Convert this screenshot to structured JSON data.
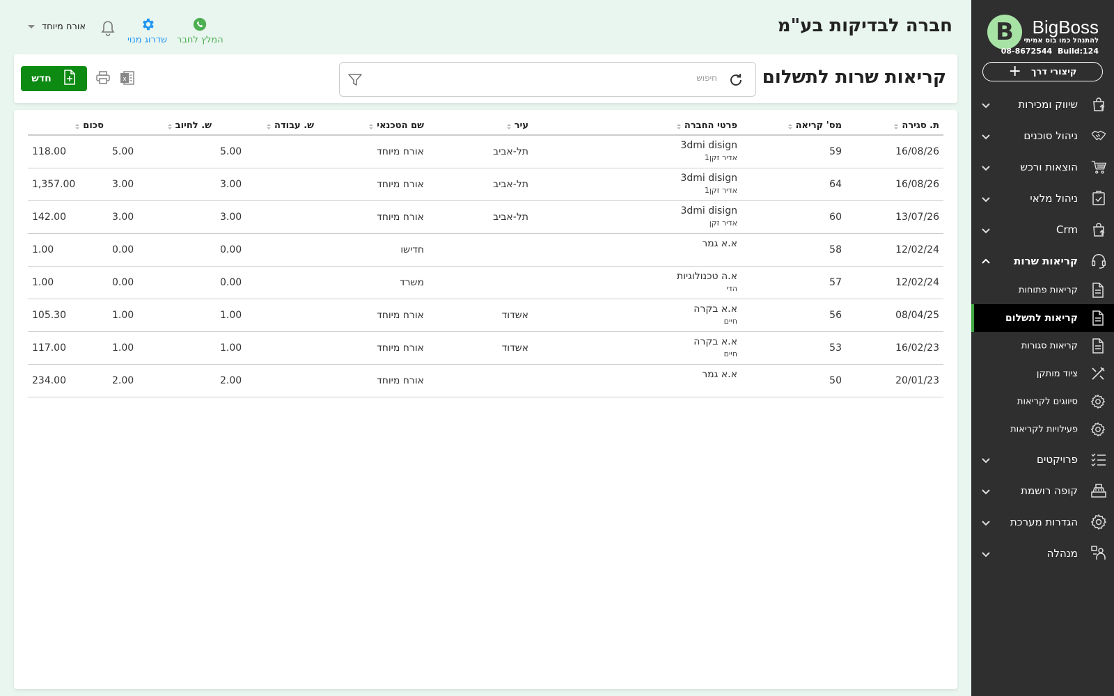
{
  "app": {
    "logo_letter": "B",
    "logo_name": "BigBoss",
    "tagline": "להתנהל כמו בוס אמיתי",
    "phone": "08-8672544",
    "build": "Build:124",
    "quick_label": "קיצורי דרך"
  },
  "sidebar": {
    "items": [
      {
        "label": "שיווק ומכירות",
        "icon": "bag-icon"
      },
      {
        "label": "ניהול סוכנים",
        "icon": "handshake-icon"
      },
      {
        "label": "הוצאות ורכש",
        "icon": "cart-icon"
      },
      {
        "label": "ניהול מלאי",
        "icon": "clipboard-icon"
      },
      {
        "label": "Crm",
        "icon": "bag-icon"
      },
      {
        "label": "קריאות שרות",
        "icon": "headset-icon"
      }
    ],
    "sub_items": [
      {
        "label": "קריאות פתוחות",
        "icon": "document-icon"
      },
      {
        "label": "קריאות לתשלום",
        "icon": "document-icon"
      },
      {
        "label": "קריאות סגורות",
        "icon": "document-icon"
      },
      {
        "label": "ציוד מותקן",
        "icon": "tools-icon"
      },
      {
        "label": "סיווגים לקריאות",
        "icon": "gear-icon"
      },
      {
        "label": "פעילויות לקריאות",
        "icon": "gear-icon"
      }
    ],
    "bottom_items": [
      {
        "label": "פרויקטים",
        "icon": "checklist-icon"
      },
      {
        "label": "קופה רושמת",
        "icon": "register-icon"
      },
      {
        "label": "הגדרות מערכת",
        "icon": "gear-icon"
      },
      {
        "label": "מנהלה",
        "icon": "admin-icon"
      }
    ]
  },
  "header": {
    "company": "חברה לבדיקות בע\"מ",
    "recommend": "המלץ לחבר",
    "upgrade": "שדרוג מנוי",
    "user": "אורח מיוחד"
  },
  "toolbar": {
    "title": "קריאות שרות לתשלום",
    "search_placeholder": "חיפוש",
    "new_label": "חדש"
  },
  "colors": {
    "primary": "#0c8a11",
    "sidebar": "#2f2f2f",
    "whatsapp": "#4caf50",
    "link": "#2196f3"
  },
  "table": {
    "columns": [
      "ת. סגירה",
      "מס' קריאה",
      "פרטי החברה",
      "עיר",
      "שם הטכנאי",
      "ש. עבודה",
      "ש. לחיוב",
      "סכום"
    ],
    "rows": [
      {
        "date": "16/08/26",
        "num": "59",
        "company": "3dmi disign",
        "contact": "אדיר זקן1",
        "city": "תל-אביב",
        "tech": "אורח מיוחד",
        "work": "5.00",
        "bill": "5.00",
        "sum": "118.00"
      },
      {
        "date": "16/08/26",
        "num": "64",
        "company": "3dmi disign",
        "contact": "אדיר זקן1",
        "city": "תל-אביב",
        "tech": "אורח מיוחד",
        "work": "3.00",
        "bill": "3.00",
        "sum": "1,357.00"
      },
      {
        "date": "13/07/26",
        "num": "60",
        "company": "3dmi disign",
        "contact": "אדיר זקן",
        "city": "תל-אביב",
        "tech": "אורח מיוחד",
        "work": "3.00",
        "bill": "3.00",
        "sum": "142.00"
      },
      {
        "date": "12/02/24",
        "num": "58",
        "company": "א.א גמר",
        "contact": "",
        "city": "",
        "tech": "חדישו",
        "work": "0.00",
        "bill": "0.00",
        "sum": "1.00"
      },
      {
        "date": "12/02/24",
        "num": "57",
        "company": "א.ה טכנולוגיות",
        "contact": "הדי",
        "city": "",
        "tech": "משרד",
        "work": "0.00",
        "bill": "0.00",
        "sum": "1.00"
      },
      {
        "date": "08/04/25",
        "num": "56",
        "company": "א.א בקרה",
        "contact": "חיים",
        "city": "אשדוד",
        "tech": "אורח מיוחד",
        "work": "1.00",
        "bill": "1.00",
        "sum": "105.30"
      },
      {
        "date": "16/02/23",
        "num": "53",
        "company": "א.א בקרה",
        "contact": "חיים",
        "city": "אשדוד",
        "tech": "אורח מיוחד",
        "work": "1.00",
        "bill": "1.00",
        "sum": "117.00"
      },
      {
        "date": "20/01/23",
        "num": "50",
        "company": "א.א גמר",
        "contact": "",
        "city": "",
        "tech": "אורח מיוחד",
        "work": "2.00",
        "bill": "2.00",
        "sum": "234.00"
      }
    ]
  }
}
